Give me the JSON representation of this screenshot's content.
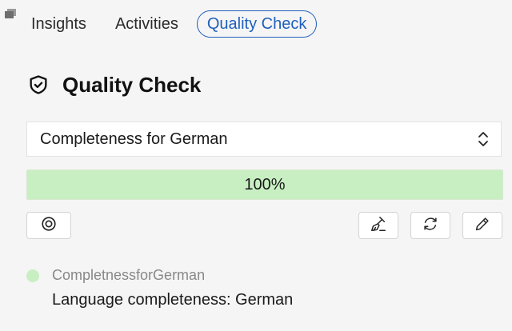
{
  "tabs": [
    {
      "label": "Insights",
      "active": false
    },
    {
      "label": "Activities",
      "active": false
    },
    {
      "label": "Quality Check",
      "active": true
    }
  ],
  "heading": {
    "title": "Quality Check",
    "icon": "shield-check-icon"
  },
  "select": {
    "value": "Completeness for German"
  },
  "progress": {
    "percent": 100,
    "label": "100%"
  },
  "toolbar": {
    "left_icon": "target-icon",
    "right_icons": [
      "clean-icon",
      "refresh-icon",
      "edit-icon"
    ]
  },
  "result": {
    "status_color": "#c8efc2",
    "id": "CompletnessforGerman",
    "description": "Language completeness: German"
  },
  "colors": {
    "accent": "#1f5fbf",
    "progress_fill": "#c8efc2",
    "background": "#f5f5f5"
  }
}
